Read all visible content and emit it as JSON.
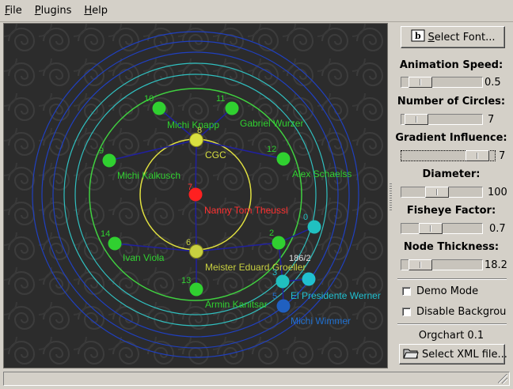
{
  "menu": [
    {
      "label": "File",
      "mnemonic": "F",
      "rest": "ile"
    },
    {
      "label": "Plugins",
      "mnemonic": "P",
      "rest": "lugins"
    },
    {
      "label": "Help",
      "mnemonic": "H",
      "rest": "elp"
    }
  ],
  "panel": {
    "select_font": {
      "mnemonic": "S",
      "rest": "elect Font...",
      "icon": "font-icon"
    },
    "sliders": [
      {
        "label": "Animation Speed:",
        "value": "0.5",
        "level": 0.12
      },
      {
        "label": "Number of Circles:",
        "value": "7",
        "level": 0.05
      },
      {
        "label": "Gradient Influence:",
        "value": "7",
        "level": 0.92
      },
      {
        "label": "Diameter:",
        "value": "100",
        "level": 0.42
      },
      {
        "label": "Fisheye Factor:",
        "value": "0.7",
        "level": 0.3
      },
      {
        "label": "Node Thickness:",
        "value": "18.2",
        "level": 0.12
      }
    ],
    "checkboxes": [
      {
        "label": "Demo Mode",
        "checked": false
      },
      {
        "label": "Disable Backgrou",
        "checked": false
      }
    ],
    "version": "Orgchart 0.1",
    "select_xml": {
      "label": "Select XML file...",
      "icon": "folder-icon"
    }
  },
  "graph": {
    "nodes": [
      {
        "id": "7",
        "name": "Nanny Tom Theussl",
        "color": "#ff2020",
        "label_color": "#ff3030"
      },
      {
        "id": "8",
        "name": "CGC",
        "color": "#d8e040",
        "label_color": "#d8e040"
      },
      {
        "id": "6",
        "name": "Meister Eduard Groeller",
        "color": "#c8d040",
        "label_color": "#c8d040"
      },
      {
        "id": "10",
        "name": "Michi Knapp",
        "color": "#30d030",
        "label_color": "#30d030"
      },
      {
        "id": "11",
        "name": "Gabriel Wurzer",
        "color": "#30d030",
        "label_color": "#30d030"
      },
      {
        "id": "9",
        "name": "Michi Kalkusch",
        "color": "#30d030",
        "label_color": "#30d030"
      },
      {
        "id": "12",
        "name": "Alex Schaelss",
        "color": "#30d030",
        "label_color": "#30d030"
      },
      {
        "id": "14",
        "name": "Ivan Viola",
        "color": "#30d030",
        "label_color": "#30d030"
      },
      {
        "id": "2",
        "name": "",
        "color": "#30d030",
        "label_color": "#30d030"
      },
      {
        "id": "13",
        "name": "Armin Kanitsar",
        "color": "#30d030",
        "label_color": "#30d030"
      },
      {
        "id": "0",
        "name": "",
        "color": "#20c0c0",
        "label_color": "#20c0c0"
      },
      {
        "id": "186/2",
        "name": "",
        "color": "#20c0c0",
        "label_color": "#e0e0e0"
      },
      {
        "id": "3",
        "name": "El Presidente Werner",
        "color": "#20c0d0",
        "label_color": "#20c0d0"
      },
      {
        "id": "5",
        "name": "Michi Wimmer",
        "color": "#2060c0",
        "label_color": "#2070d0"
      },
      {
        "id": "",
        "name": "",
        "color": "#2060c0",
        "label_color": "#2060c0"
      }
    ],
    "colors": {
      "ring_inner": "#e0e040",
      "ring_green": "#40d040",
      "ring_cyan": "#30c0c0",
      "ring_blue": "#2040c0",
      "edge": "#2020a0"
    }
  }
}
